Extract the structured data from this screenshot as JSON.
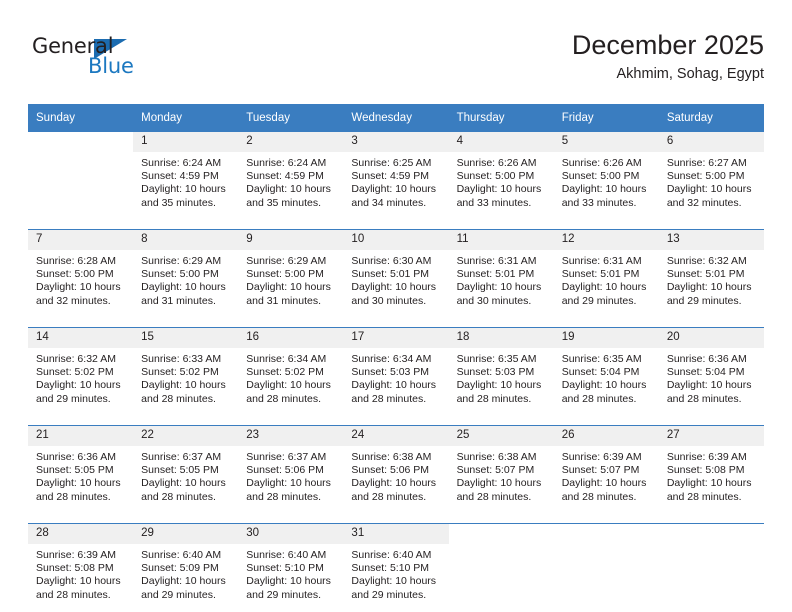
{
  "brand": {
    "name_part1": "General",
    "name_part2": "Blue",
    "logo_icon": "triangle-icon",
    "accent_color": "#1c6cb0"
  },
  "header": {
    "title": "December 2025",
    "subtitle": "Akhmim, Sohag, Egypt"
  },
  "theme": {
    "header_row_bg": "#3a7dc0",
    "daynum_bg": "#f0f0f0",
    "text_color": "#231f20"
  },
  "calendar": {
    "weekday_headers": [
      "Sunday",
      "Monday",
      "Tuesday",
      "Wednesday",
      "Thursday",
      "Friday",
      "Saturday"
    ],
    "weeks": [
      [
        {
          "day": "",
          "sunrise": "",
          "sunset": "",
          "daylight_line1": "",
          "daylight_line2": "",
          "empty": true
        },
        {
          "day": "1",
          "sunrise": "Sunrise: 6:24 AM",
          "sunset": "Sunset: 4:59 PM",
          "daylight_line1": "Daylight: 10 hours",
          "daylight_line2": "and 35 minutes.",
          "empty": false
        },
        {
          "day": "2",
          "sunrise": "Sunrise: 6:24 AM",
          "sunset": "Sunset: 4:59 PM",
          "daylight_line1": "Daylight: 10 hours",
          "daylight_line2": "and 35 minutes.",
          "empty": false
        },
        {
          "day": "3",
          "sunrise": "Sunrise: 6:25 AM",
          "sunset": "Sunset: 4:59 PM",
          "daylight_line1": "Daylight: 10 hours",
          "daylight_line2": "and 34 minutes.",
          "empty": false
        },
        {
          "day": "4",
          "sunrise": "Sunrise: 6:26 AM",
          "sunset": "Sunset: 5:00 PM",
          "daylight_line1": "Daylight: 10 hours",
          "daylight_line2": "and 33 minutes.",
          "empty": false
        },
        {
          "day": "5",
          "sunrise": "Sunrise: 6:26 AM",
          "sunset": "Sunset: 5:00 PM",
          "daylight_line1": "Daylight: 10 hours",
          "daylight_line2": "and 33 minutes.",
          "empty": false
        },
        {
          "day": "6",
          "sunrise": "Sunrise: 6:27 AM",
          "sunset": "Sunset: 5:00 PM",
          "daylight_line1": "Daylight: 10 hours",
          "daylight_line2": "and 32 minutes.",
          "empty": false
        }
      ],
      [
        {
          "day": "7",
          "sunrise": "Sunrise: 6:28 AM",
          "sunset": "Sunset: 5:00 PM",
          "daylight_line1": "Daylight: 10 hours",
          "daylight_line2": "and 32 minutes.",
          "empty": false
        },
        {
          "day": "8",
          "sunrise": "Sunrise: 6:29 AM",
          "sunset": "Sunset: 5:00 PM",
          "daylight_line1": "Daylight: 10 hours",
          "daylight_line2": "and 31 minutes.",
          "empty": false
        },
        {
          "day": "9",
          "sunrise": "Sunrise: 6:29 AM",
          "sunset": "Sunset: 5:00 PM",
          "daylight_line1": "Daylight: 10 hours",
          "daylight_line2": "and 31 minutes.",
          "empty": false
        },
        {
          "day": "10",
          "sunrise": "Sunrise: 6:30 AM",
          "sunset": "Sunset: 5:01 PM",
          "daylight_line1": "Daylight: 10 hours",
          "daylight_line2": "and 30 minutes.",
          "empty": false
        },
        {
          "day": "11",
          "sunrise": "Sunrise: 6:31 AM",
          "sunset": "Sunset: 5:01 PM",
          "daylight_line1": "Daylight: 10 hours",
          "daylight_line2": "and 30 minutes.",
          "empty": false
        },
        {
          "day": "12",
          "sunrise": "Sunrise: 6:31 AM",
          "sunset": "Sunset: 5:01 PM",
          "daylight_line1": "Daylight: 10 hours",
          "daylight_line2": "and 29 minutes.",
          "empty": false
        },
        {
          "day": "13",
          "sunrise": "Sunrise: 6:32 AM",
          "sunset": "Sunset: 5:01 PM",
          "daylight_line1": "Daylight: 10 hours",
          "daylight_line2": "and 29 minutes.",
          "empty": false
        }
      ],
      [
        {
          "day": "14",
          "sunrise": "Sunrise: 6:32 AM",
          "sunset": "Sunset: 5:02 PM",
          "daylight_line1": "Daylight: 10 hours",
          "daylight_line2": "and 29 minutes.",
          "empty": false
        },
        {
          "day": "15",
          "sunrise": "Sunrise: 6:33 AM",
          "sunset": "Sunset: 5:02 PM",
          "daylight_line1": "Daylight: 10 hours",
          "daylight_line2": "and 28 minutes.",
          "empty": false
        },
        {
          "day": "16",
          "sunrise": "Sunrise: 6:34 AM",
          "sunset": "Sunset: 5:02 PM",
          "daylight_line1": "Daylight: 10 hours",
          "daylight_line2": "and 28 minutes.",
          "empty": false
        },
        {
          "day": "17",
          "sunrise": "Sunrise: 6:34 AM",
          "sunset": "Sunset: 5:03 PM",
          "daylight_line1": "Daylight: 10 hours",
          "daylight_line2": "and 28 minutes.",
          "empty": false
        },
        {
          "day": "18",
          "sunrise": "Sunrise: 6:35 AM",
          "sunset": "Sunset: 5:03 PM",
          "daylight_line1": "Daylight: 10 hours",
          "daylight_line2": "and 28 minutes.",
          "empty": false
        },
        {
          "day": "19",
          "sunrise": "Sunrise: 6:35 AM",
          "sunset": "Sunset: 5:04 PM",
          "daylight_line1": "Daylight: 10 hours",
          "daylight_line2": "and 28 minutes.",
          "empty": false
        },
        {
          "day": "20",
          "sunrise": "Sunrise: 6:36 AM",
          "sunset": "Sunset: 5:04 PM",
          "daylight_line1": "Daylight: 10 hours",
          "daylight_line2": "and 28 minutes.",
          "empty": false
        }
      ],
      [
        {
          "day": "21",
          "sunrise": "Sunrise: 6:36 AM",
          "sunset": "Sunset: 5:05 PM",
          "daylight_line1": "Daylight: 10 hours",
          "daylight_line2": "and 28 minutes.",
          "empty": false
        },
        {
          "day": "22",
          "sunrise": "Sunrise: 6:37 AM",
          "sunset": "Sunset: 5:05 PM",
          "daylight_line1": "Daylight: 10 hours",
          "daylight_line2": "and 28 minutes.",
          "empty": false
        },
        {
          "day": "23",
          "sunrise": "Sunrise: 6:37 AM",
          "sunset": "Sunset: 5:06 PM",
          "daylight_line1": "Daylight: 10 hours",
          "daylight_line2": "and 28 minutes.",
          "empty": false
        },
        {
          "day": "24",
          "sunrise": "Sunrise: 6:38 AM",
          "sunset": "Sunset: 5:06 PM",
          "daylight_line1": "Daylight: 10 hours",
          "daylight_line2": "and 28 minutes.",
          "empty": false
        },
        {
          "day": "25",
          "sunrise": "Sunrise: 6:38 AM",
          "sunset": "Sunset: 5:07 PM",
          "daylight_line1": "Daylight: 10 hours",
          "daylight_line2": "and 28 minutes.",
          "empty": false
        },
        {
          "day": "26",
          "sunrise": "Sunrise: 6:39 AM",
          "sunset": "Sunset: 5:07 PM",
          "daylight_line1": "Daylight: 10 hours",
          "daylight_line2": "and 28 minutes.",
          "empty": false
        },
        {
          "day": "27",
          "sunrise": "Sunrise: 6:39 AM",
          "sunset": "Sunset: 5:08 PM",
          "daylight_line1": "Daylight: 10 hours",
          "daylight_line2": "and 28 minutes.",
          "empty": false
        }
      ],
      [
        {
          "day": "28",
          "sunrise": "Sunrise: 6:39 AM",
          "sunset": "Sunset: 5:08 PM",
          "daylight_line1": "Daylight: 10 hours",
          "daylight_line2": "and 28 minutes.",
          "empty": false
        },
        {
          "day": "29",
          "sunrise": "Sunrise: 6:40 AM",
          "sunset": "Sunset: 5:09 PM",
          "daylight_line1": "Daylight: 10 hours",
          "daylight_line2": "and 29 minutes.",
          "empty": false
        },
        {
          "day": "30",
          "sunrise": "Sunrise: 6:40 AM",
          "sunset": "Sunset: 5:10 PM",
          "daylight_line1": "Daylight: 10 hours",
          "daylight_line2": "and 29 minutes.",
          "empty": false
        },
        {
          "day": "31",
          "sunrise": "Sunrise: 6:40 AM",
          "sunset": "Sunset: 5:10 PM",
          "daylight_line1": "Daylight: 10 hours",
          "daylight_line2": "and 29 minutes.",
          "empty": false
        },
        {
          "day": "",
          "sunrise": "",
          "sunset": "",
          "daylight_line1": "",
          "daylight_line2": "",
          "empty": true
        },
        {
          "day": "",
          "sunrise": "",
          "sunset": "",
          "daylight_line1": "",
          "daylight_line2": "",
          "empty": true
        },
        {
          "day": "",
          "sunrise": "",
          "sunset": "",
          "daylight_line1": "",
          "daylight_line2": "",
          "empty": true
        }
      ]
    ]
  }
}
